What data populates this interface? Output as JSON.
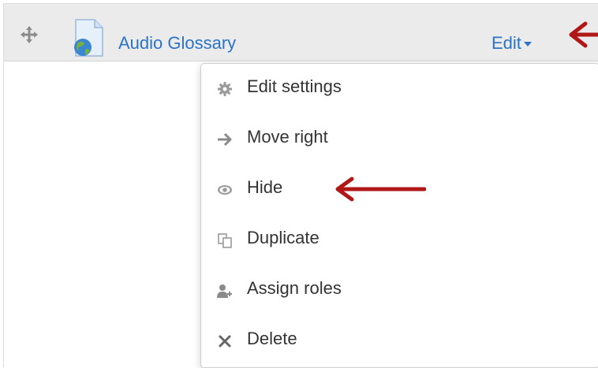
{
  "activity": {
    "name": "Audio Glossary"
  },
  "edit_menu": {
    "label": "Edit"
  },
  "dropdown": {
    "items": [
      {
        "label": "Edit settings",
        "icon": "gear-icon"
      },
      {
        "label": "Move right",
        "icon": "arrow-right-icon"
      },
      {
        "label": "Hide",
        "icon": "eye-icon"
      },
      {
        "label": "Duplicate",
        "icon": "duplicate-icon"
      },
      {
        "label": "Assign roles",
        "icon": "user-plus-icon"
      },
      {
        "label": "Delete",
        "icon": "close-icon"
      }
    ]
  },
  "colors": {
    "link": "#2a73c6",
    "annotation_arrow": "#b01818",
    "row_bg": "#ebebeb"
  }
}
